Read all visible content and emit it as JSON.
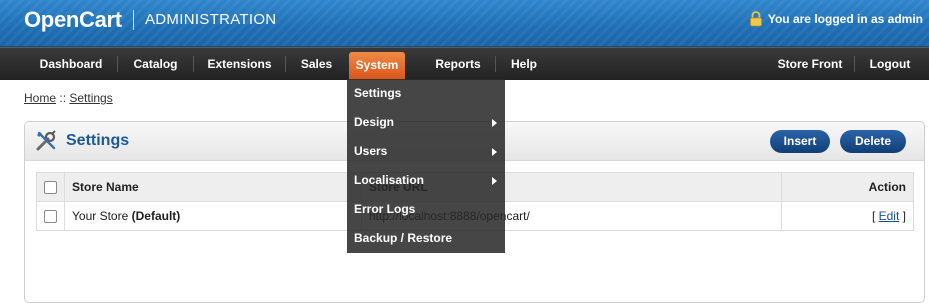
{
  "header": {
    "logo": "OpenCart",
    "admin_label": "ADMINISTRATION",
    "logged_in_text": "You are logged in as admin"
  },
  "nav": {
    "items": [
      "Dashboard",
      "Catalog",
      "Extensions",
      "Sales",
      "System",
      "Reports",
      "Help"
    ],
    "right_items": [
      "Store Front",
      "Logout"
    ],
    "active": "System"
  },
  "dropdown": {
    "items": [
      "Settings",
      "Design",
      "Users",
      "Localisation",
      "Error Logs",
      "Backup / Restore"
    ]
  },
  "breadcrumb": {
    "home": "Home",
    "separator": "::",
    "current": "Settings"
  },
  "box": {
    "title": "Settings",
    "insert_label": "Insert",
    "delete_label": "Delete"
  },
  "table": {
    "headers": {
      "store_name": "Store Name",
      "store_url": "Store URL",
      "action": "Action"
    },
    "rows": [
      {
        "name": "Your Store",
        "default_tag": "(Default)",
        "url": "http://localhost:8888/opencart/",
        "action_open": "[",
        "action": "Edit",
        "action_close": "]"
      }
    ]
  },
  "colors": {
    "header_blue": "#1f6fb5",
    "nav_dark": "#2a2a2a",
    "active_orange": "#e06a2c",
    "button_blue": "#1a4c8a",
    "title_blue": "#1b5a97"
  }
}
